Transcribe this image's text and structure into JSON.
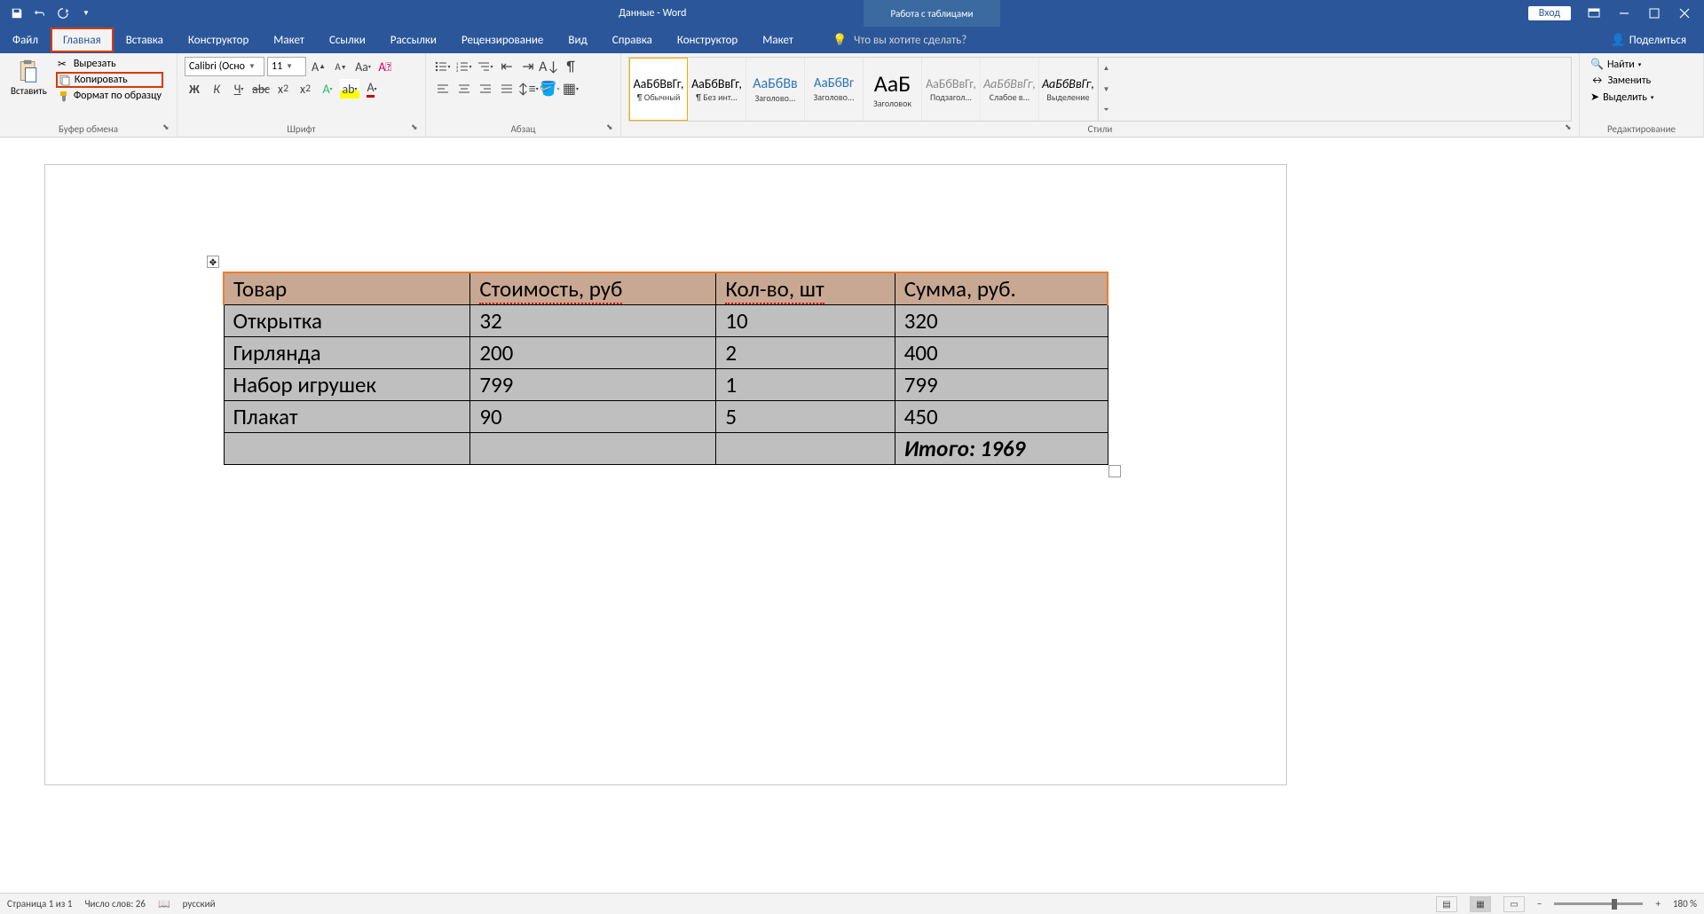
{
  "title": "Данные  -  Word",
  "table_tools": "Работа с таблицами",
  "login": "Вход",
  "tabs": [
    "Файл",
    "Главная",
    "Вставка",
    "Конструктор",
    "Макет",
    "Ссылки",
    "Рассылки",
    "Рецензирование",
    "Вид",
    "Справка",
    "Конструктор",
    "Макет"
  ],
  "tell_me": "Что вы хотите сделать?",
  "share": "Поделиться",
  "clipboard": {
    "paste": "Вставить",
    "cut": "Вырезать",
    "copy": "Копировать",
    "format_painter": "Формат по образцу",
    "title": "Буфер обмена"
  },
  "font": {
    "name": "Calibri (Осно",
    "size": "11",
    "title": "Шрифт"
  },
  "paragraph": {
    "title": "Абзац"
  },
  "styles": {
    "title": "Стили",
    "items": [
      {
        "preview": "АаБбВвГг,",
        "label": "¶ Обычный"
      },
      {
        "preview": "АаБбВвГг,",
        "label": "¶ Без инт..."
      },
      {
        "preview": "АаБбВв",
        "label": "Заголово..."
      },
      {
        "preview": "АаБбВг",
        "label": "Заголово..."
      },
      {
        "preview": "АаБ",
        "label": "Заголовок"
      },
      {
        "preview": "АаБбВвГг,",
        "label": "Подзагол..."
      },
      {
        "preview": "АаБбВвГг,",
        "label": "Слабое в..."
      },
      {
        "preview": "АаБбВвГг,",
        "label": "Выделение"
      }
    ]
  },
  "editing": {
    "find": "Найти",
    "replace": "Заменить",
    "select": "Выделить",
    "title": "Редактирование"
  },
  "table": {
    "headers": [
      "Товар",
      "Стоимость, руб",
      "Кол-во, шт",
      "Сумма, руб."
    ],
    "rows": [
      [
        "Открытка",
        "32",
        "10",
        "320"
      ],
      [
        "Гирлянда",
        "200",
        "2",
        "400"
      ],
      [
        "Набор игрушек",
        "799",
        "1",
        "799"
      ],
      [
        "Плакат",
        "90",
        "5",
        "450"
      ]
    ],
    "total": "Итого: 1969"
  },
  "status": {
    "page": "Страница 1 из 1",
    "words": "Число слов: 26",
    "language": "русский",
    "zoom": "180 %"
  }
}
